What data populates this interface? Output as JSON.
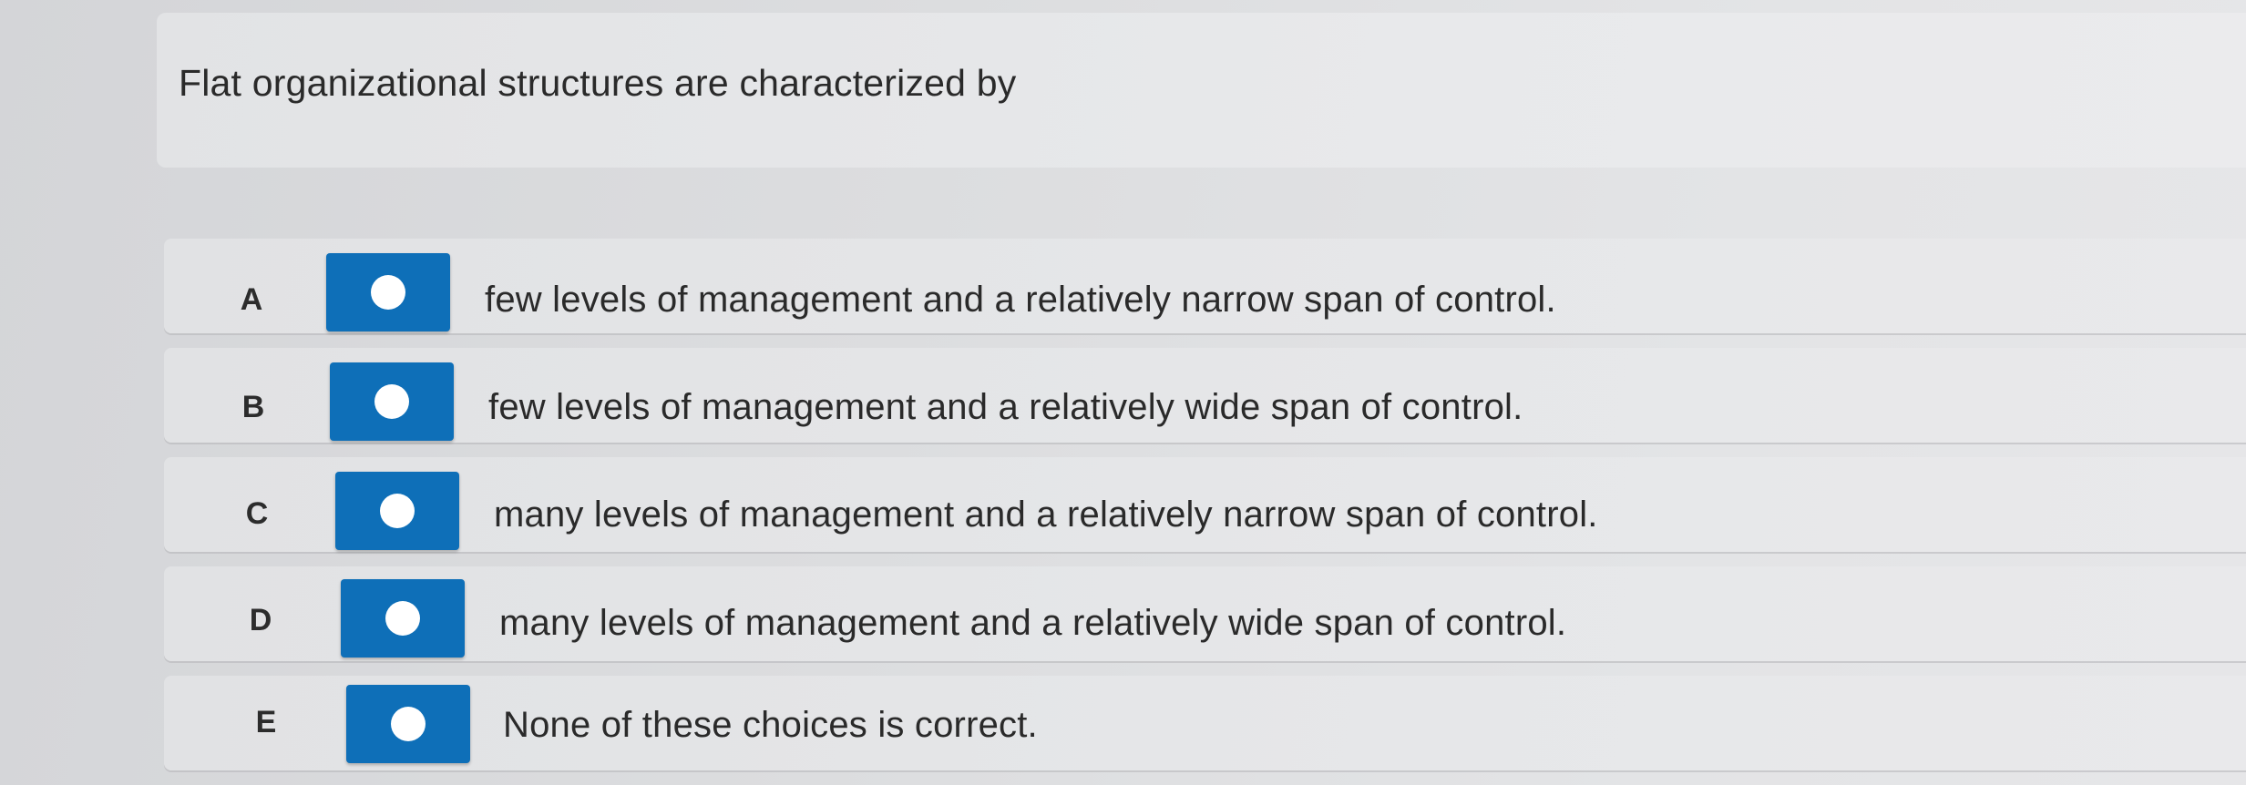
{
  "question": {
    "text": "Flat organizational structures are characterized by"
  },
  "choices": [
    {
      "letter": "A",
      "text": "few levels of management and a relatively narrow span of control.",
      "selected": false
    },
    {
      "letter": "B",
      "text": "few levels of management and a relatively wide span of control.",
      "selected": false
    },
    {
      "letter": "C",
      "text": "many levels of management and a relatively narrow span of control.",
      "selected": false
    },
    {
      "letter": "D",
      "text": "many levels of management and a relatively wide span of control.",
      "selected": false
    },
    {
      "letter": "E",
      "text": "None of these choices is correct.",
      "selected": false
    }
  ],
  "colors": {
    "radio_fill": "#0e6fb8",
    "radio_dot": "#ffffff"
  }
}
